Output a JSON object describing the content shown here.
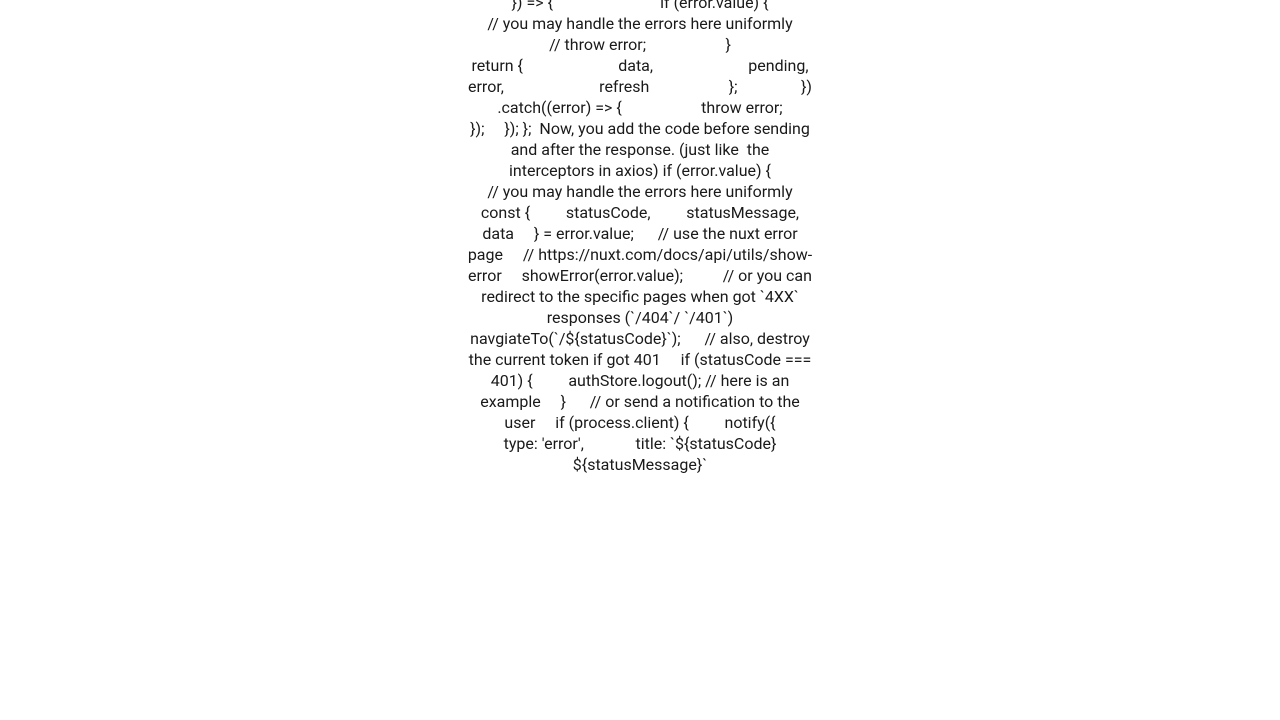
{
  "content": {
    "text": "}) => {                           if (error.value) {                               // you may handle the errors here uniformly                               // throw error;                    }                                          return {                        data,                        pending,                        error,                        refresh                    };                })            .catch((error) => {                    throw error;                });     }); };  Now, you add the code before sending and after the response. (just like  the interceptors in axios) if (error.value) {                               // you may handle the errors here uniformly     const {         statusCode,         statusMessage,         data     } = error.value;      // use the nuxt error page     // https://nuxt.com/docs/api/utils/show-error     showError(error.value);          // or you can redirect to the specific pages when got `4XX` responses (`/404`/ `/401`)     navgiateTo(`/${statusCode}`);      // also, destroy the current token if got 401     if (statusCode === 401) {         authStore.logout(); // here is an example     }      // or send a notification to the user     if (process.client) {         notify({             type: 'error',             title: `${statusCode} ${statusMessage}`"
  }
}
